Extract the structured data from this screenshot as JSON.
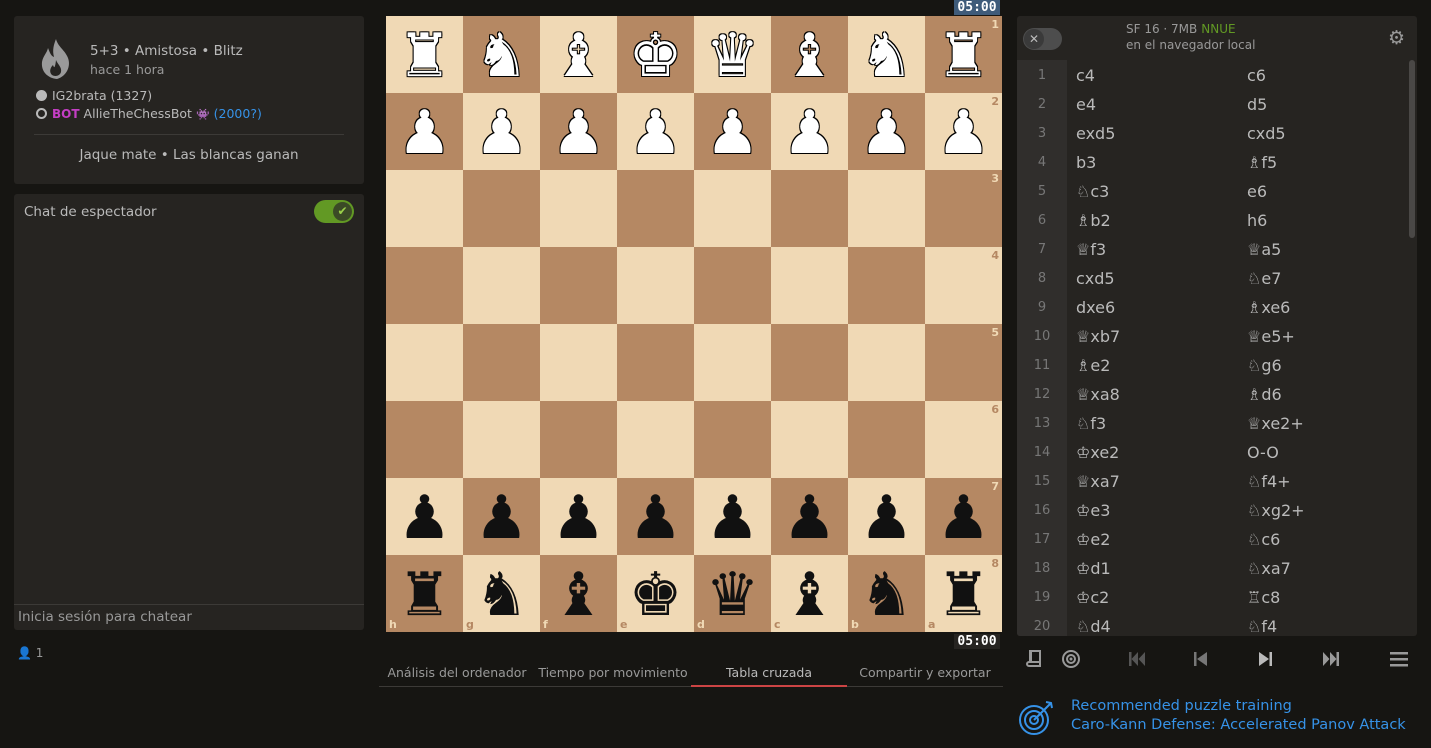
{
  "game": {
    "title": "5+3 • Amistosa • Blitz",
    "time_ago": "hace 1 hora",
    "white_player": "IG2brata (1327)",
    "black_bot_tag": "BOT",
    "black_player": "AllieTheChessBot",
    "black_icon": "alien-icon",
    "black_rating": "(2000?)",
    "result": "Jaque mate • Las blancas ganan"
  },
  "chat": {
    "title": "Chat de espectador",
    "toggle_on": true,
    "input_placeholder": "Inicia sesión para chatear",
    "viewer_count": "1"
  },
  "clocks": {
    "top": "05:00",
    "bottom": "05:00"
  },
  "board": {
    "orientation": "black",
    "ranks": [
      "1",
      "2",
      "3",
      "4",
      "5",
      "6",
      "7",
      "8"
    ],
    "files": [
      "h",
      "g",
      "f",
      "e",
      "d",
      "c",
      "b",
      "a"
    ],
    "rows": [
      [
        "wR",
        "wN",
        "wB",
        "wK",
        "wQ",
        "wB",
        "wN",
        "wR"
      ],
      [
        "wP",
        "wP",
        "wP",
        "wP",
        "wP",
        "wP",
        "wP",
        "wP"
      ],
      [
        "",
        "",
        "",
        "",
        "",
        "",
        "",
        ""
      ],
      [
        "",
        "",
        "",
        "",
        "",
        "",
        "",
        ""
      ],
      [
        "",
        "",
        "",
        "",
        "",
        "",
        "",
        ""
      ],
      [
        "",
        "",
        "",
        "",
        "",
        "",
        "",
        ""
      ],
      [
        "bP",
        "bP",
        "bP",
        "bP",
        "bP",
        "bP",
        "bP",
        "bP"
      ],
      [
        "bR",
        "bN",
        "bB",
        "bK",
        "bQ",
        "bB",
        "bN",
        "bR"
      ]
    ]
  },
  "under_tabs": [
    {
      "label": "Análisis del ordenador",
      "active": false
    },
    {
      "label": "Tiempo por movimiento",
      "active": false
    },
    {
      "label": "Tabla cruzada",
      "active": true
    },
    {
      "label": "Compartir y exportar",
      "active": false
    }
  ],
  "engine": {
    "name": "SF 16 · 7MB",
    "nnue": "NNUE",
    "location": "en el navegador local",
    "enabled": false
  },
  "moves": [
    [
      "1",
      "c4",
      "c6"
    ],
    [
      "2",
      "e4",
      "d5"
    ],
    [
      "3",
      "exd5",
      "cxd5"
    ],
    [
      "4",
      "b3",
      "♗f5"
    ],
    [
      "5",
      "♘c3",
      "e6"
    ],
    [
      "6",
      "♗b2",
      "h6"
    ],
    [
      "7",
      "♕f3",
      "♕a5"
    ],
    [
      "8",
      "cxd5",
      "♘e7"
    ],
    [
      "9",
      "dxe6",
      "♗xe6"
    ],
    [
      "10",
      "♕xb7",
      "♕e5+"
    ],
    [
      "11",
      "♗e2",
      "♘g6"
    ],
    [
      "12",
      "♕xa8",
      "♗d6"
    ],
    [
      "13",
      "♘f3",
      "♕xe2+"
    ],
    [
      "14",
      "♔xe2",
      "O-O"
    ],
    [
      "15",
      "♕xa7",
      "♘f4+"
    ],
    [
      "16",
      "♔e3",
      "♘xg2+"
    ],
    [
      "17",
      "♔e2",
      "♘c6"
    ],
    [
      "18",
      "♔d1",
      "♘xa7"
    ],
    [
      "19",
      "♔c2",
      "♖c8"
    ],
    [
      "20",
      "♘d4",
      "♘f4"
    ]
  ],
  "controls": {
    "book": "book-icon",
    "practice": "target-icon",
    "first": "first-move-icon",
    "prev": "prev-move-icon",
    "next": "next-move-icon",
    "last": "last-move-icon",
    "menu": "hamburger-menu-icon"
  },
  "puzzle": {
    "line1": "Recommended puzzle training",
    "line2": "Caro-Kann Defense: Accelerated Panov Attack"
  }
}
